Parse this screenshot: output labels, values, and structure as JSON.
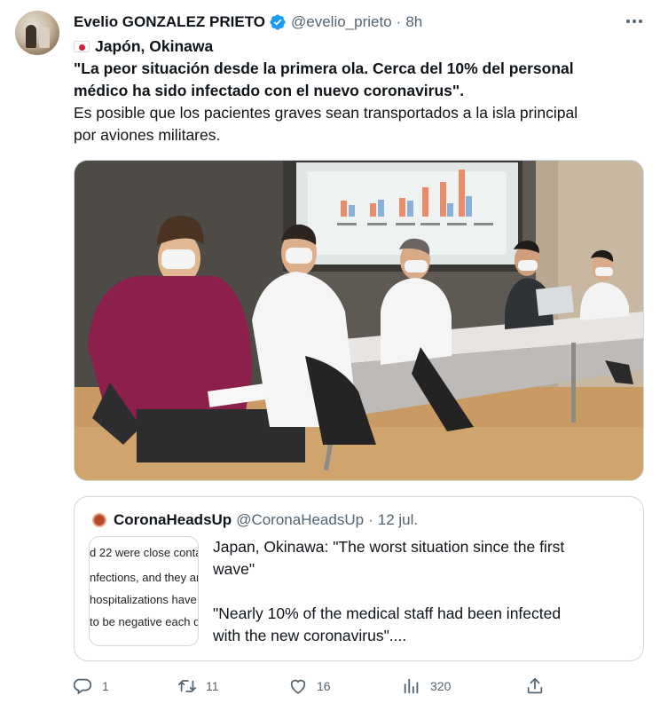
{
  "author": {
    "name": "Evelio GONZALEZ PRIETO",
    "handle": "@evelio_prieto",
    "separator": "·",
    "time": "8h"
  },
  "tweet": {
    "location": "Japón, Okinawa",
    "quote_line1": "\"La peor situación desde la primera ola. Cerca del 10% del personal",
    "quote_line2": "médico ha sido infectado con el nuevo coronavirus\".",
    "text_line1": "Es posible que los pacientes graves sean transportados a la isla principal",
    "text_line2": "por aviones militares."
  },
  "quoted": {
    "name": "CoronaHeadsUp",
    "handle": "@CoronaHeadsUp",
    "separator": "·",
    "time": "12 jul.",
    "thumb_lines": [
      "d 22 were close conta",
      "nfections, and they are",
      "hospitalizations have",
      "to be negative each d"
    ],
    "text_line1": "Japan, Okinawa: \"The worst situation since the first",
    "text_line2": "wave\"",
    "text_line3": "\"Nearly 10% of the medical staff had been infected",
    "text_line4": "with the new coronavirus\"...."
  },
  "actions": {
    "replies": "1",
    "retweets": "11",
    "likes": "16",
    "views": "320"
  },
  "colors": {
    "secondary_text": "#536471",
    "verified_blue": "#1d9bf0",
    "border": "#cfd9de"
  },
  "icons": [
    "verified-icon",
    "more-icon",
    "reply-icon",
    "retweet-icon",
    "like-icon",
    "views-icon",
    "share-icon"
  ]
}
